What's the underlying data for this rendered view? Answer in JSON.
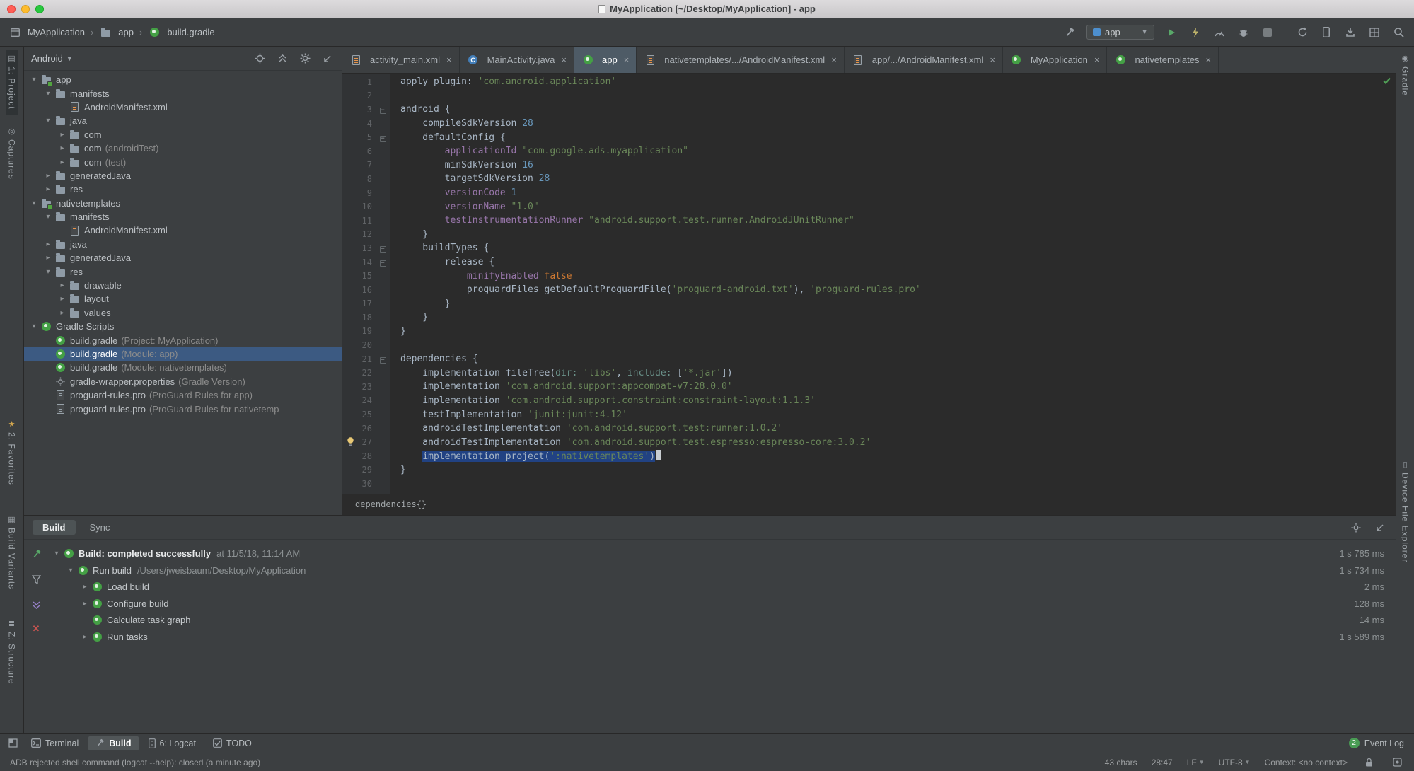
{
  "colors": {
    "editor_selection": "#214283",
    "tree_selection": "#3C5A82",
    "string_green": "#6A8759",
    "number_blue": "#6897BB",
    "keyword_orange": "#CC7832",
    "member_purple": "#9876AA",
    "gradle_green": "#44A045",
    "run_green": "#59A869",
    "close_red": "#C75450",
    "favorites_star": "#D0A54E"
  },
  "titlebar": {
    "title": "MyApplication [~/Desktop/MyApplication] - app"
  },
  "toolbar": {
    "breadcrumbs": [
      {
        "label": "MyApplication",
        "icon": "project"
      },
      {
        "label": "app",
        "icon": "folder"
      },
      {
        "label": "build.gradle",
        "icon": "gradle"
      }
    ],
    "run_config": "app"
  },
  "left_strip": {
    "top": [
      {
        "label": "1: Project",
        "icon": "project-tool",
        "active": true
      },
      {
        "label": "Captures",
        "icon": "captures",
        "active": false
      }
    ],
    "bottom": [
      {
        "label": "2: Favorites",
        "icon": "favorites",
        "active": false
      },
      {
        "label": "Build Variants",
        "icon": "build-variants",
        "active": false
      },
      {
        "label": "Z: Structure",
        "icon": "structure",
        "active": false
      }
    ]
  },
  "right_strip": {
    "top": [
      {
        "label": "Gradle",
        "icon": "gradle-strip",
        "active": false
      }
    ],
    "bottom": [
      {
        "label": "Device File Explorer",
        "icon": "device-explorer",
        "active": false
      }
    ]
  },
  "project": {
    "view": "Android",
    "tree": [
      {
        "indent": 0,
        "arrow": "▾",
        "icon": "module",
        "label": "app",
        "note": "",
        "selected": false
      },
      {
        "indent": 1,
        "arrow": "▾",
        "icon": "folder",
        "label": "manifests",
        "note": "",
        "selected": false
      },
      {
        "indent": 2,
        "arrow": "",
        "icon": "manifest",
        "label": "AndroidManifest.xml",
        "note": "",
        "selected": false
      },
      {
        "indent": 1,
        "arrow": "▾",
        "icon": "folder",
        "label": "java",
        "note": "",
        "selected": false
      },
      {
        "indent": 2,
        "arrow": "▸",
        "icon": "package",
        "label": "com",
        "note": "",
        "selected": false
      },
      {
        "indent": 2,
        "arrow": "▸",
        "icon": "package",
        "label": "com",
        "note": "(androidTest)",
        "selected": false
      },
      {
        "indent": 2,
        "arrow": "▸",
        "icon": "package",
        "label": "com",
        "note": "(test)",
        "selected": false
      },
      {
        "indent": 1,
        "arrow": "▸",
        "icon": "folder",
        "label": "generatedJava",
        "note": "",
        "selected": false
      },
      {
        "indent": 1,
        "arrow": "▸",
        "icon": "folder",
        "label": "res",
        "note": "",
        "selected": false
      },
      {
        "indent": 0,
        "arrow": "▾",
        "icon": "module",
        "label": "nativetemplates",
        "note": "",
        "selected": false
      },
      {
        "indent": 1,
        "arrow": "▾",
        "icon": "folder",
        "label": "manifests",
        "note": "",
        "selected": false
      },
      {
        "indent": 2,
        "arrow": "",
        "icon": "manifest",
        "label": "AndroidManifest.xml",
        "note": "",
        "selected": false
      },
      {
        "indent": 1,
        "arrow": "▸",
        "icon": "folder",
        "label": "java",
        "note": "",
        "selected": false
      },
      {
        "indent": 1,
        "arrow": "▸",
        "icon": "folder",
        "label": "generatedJava",
        "note": "",
        "selected": false
      },
      {
        "indent": 1,
        "arrow": "▾",
        "icon": "folder",
        "label": "res",
        "note": "",
        "selected": false
      },
      {
        "indent": 2,
        "arrow": "▸",
        "icon": "folder",
        "label": "drawable",
        "note": "",
        "selected": false
      },
      {
        "indent": 2,
        "arrow": "▸",
        "icon": "folder",
        "label": "layout",
        "note": "",
        "selected": false
      },
      {
        "indent": 2,
        "arrow": "▸",
        "icon": "folder",
        "label": "values",
        "note": "",
        "selected": false
      },
      {
        "indent": 0,
        "arrow": "▾",
        "icon": "gradle",
        "label": "Gradle Scripts",
        "note": "",
        "selected": false
      },
      {
        "indent": 1,
        "arrow": "",
        "icon": "gradle",
        "label": "build.gradle",
        "note": "(Project: MyApplication)",
        "selected": false
      },
      {
        "indent": 1,
        "arrow": "",
        "icon": "gradle",
        "label": "build.gradle",
        "note": "(Module: app)",
        "selected": true
      },
      {
        "indent": 1,
        "arrow": "",
        "icon": "gradle",
        "label": "build.gradle",
        "note": "(Module: nativetemplates)",
        "selected": false
      },
      {
        "indent": 1,
        "arrow": "",
        "icon": "wrapper",
        "label": "gradle-wrapper.properties",
        "note": "(Gradle Version)",
        "selected": false
      },
      {
        "indent": 1,
        "arrow": "",
        "icon": "textfile",
        "label": "proguard-rules.pro",
        "note": "(ProGuard Rules for app)",
        "selected": false
      },
      {
        "indent": 1,
        "arrow": "",
        "icon": "textfile",
        "label": "proguard-rules.pro",
        "note": "(ProGuard Rules for nativetemp",
        "selected": false
      }
    ]
  },
  "editor": {
    "active_index": 2,
    "tabs": [
      {
        "label": "activity_main.xml",
        "icon": "xml"
      },
      {
        "label": "MainActivity.java",
        "icon": "class"
      },
      {
        "label": "app",
        "icon": "gradle"
      },
      {
        "label": "nativetemplates/.../AndroidManifest.xml",
        "icon": "manifest"
      },
      {
        "label": "app/.../AndroidManifest.xml",
        "icon": "manifest"
      },
      {
        "label": "MyApplication",
        "icon": "gradle"
      },
      {
        "label": "nativetemplates",
        "icon": "gradle"
      }
    ],
    "breadcrumb": "dependencies{}",
    "lines": [
      {
        "num": "1",
        "segs": [
          [
            "p",
            "apply plugin: "
          ],
          [
            "s",
            "'com.android.application'"
          ]
        ]
      },
      {
        "num": "2",
        "segs": []
      },
      {
        "num": "3",
        "fold": true,
        "segs": [
          [
            "p",
            "android {"
          ]
        ]
      },
      {
        "num": "4",
        "segs": [
          [
            "p",
            "    compileSdkVersion "
          ],
          [
            "n",
            "28"
          ]
        ]
      },
      {
        "num": "5",
        "fold": true,
        "segs": [
          [
            "p",
            "    defaultConfig {"
          ]
        ]
      },
      {
        "num": "6",
        "segs": [
          [
            "p",
            "        "
          ],
          [
            "m",
            "applicationId"
          ],
          [
            "p",
            " "
          ],
          [
            "s",
            "\"com.google.ads.myapplication\""
          ]
        ]
      },
      {
        "num": "7",
        "segs": [
          [
            "p",
            "        minSdkVersion "
          ],
          [
            "n",
            "16"
          ]
        ]
      },
      {
        "num": "8",
        "segs": [
          [
            "p",
            "        targetSdkVersion "
          ],
          [
            "n",
            "28"
          ]
        ]
      },
      {
        "num": "9",
        "segs": [
          [
            "p",
            "        "
          ],
          [
            "m",
            "versionCode"
          ],
          [
            "p",
            " "
          ],
          [
            "n",
            "1"
          ]
        ]
      },
      {
        "num": "10",
        "segs": [
          [
            "p",
            "        "
          ],
          [
            "m",
            "versionName"
          ],
          [
            "p",
            " "
          ],
          [
            "s",
            "\"1.0\""
          ]
        ]
      },
      {
        "num": "11",
        "segs": [
          [
            "p",
            "        "
          ],
          [
            "m",
            "testInstrumentationRunner"
          ],
          [
            "p",
            " "
          ],
          [
            "s",
            "\"android.support.test.runner.AndroidJUnitRunner\""
          ]
        ]
      },
      {
        "num": "12",
        "segs": [
          [
            "p",
            "    }"
          ]
        ]
      },
      {
        "num": "13",
        "fold": true,
        "segs": [
          [
            "p",
            "    buildTypes {"
          ]
        ]
      },
      {
        "num": "14",
        "fold": true,
        "segs": [
          [
            "p",
            "        release {"
          ]
        ]
      },
      {
        "num": "15",
        "segs": [
          [
            "p",
            "            "
          ],
          [
            "m",
            "minifyEnabled"
          ],
          [
            "p",
            " "
          ],
          [
            "k",
            "false"
          ]
        ]
      },
      {
        "num": "16",
        "segs": [
          [
            "p",
            "            proguardFiles getDefaultProguardFile("
          ],
          [
            "s",
            "'proguard-android.txt'"
          ],
          [
            "p",
            "), "
          ],
          [
            "s",
            "'proguard-rules.pro'"
          ]
        ]
      },
      {
        "num": "17",
        "segs": [
          [
            "p",
            "        }"
          ]
        ]
      },
      {
        "num": "18",
        "segs": [
          [
            "p",
            "    }"
          ]
        ]
      },
      {
        "num": "19",
        "segs": [
          [
            "p",
            "}"
          ]
        ]
      },
      {
        "num": "20",
        "segs": []
      },
      {
        "num": "21",
        "fold": true,
        "segs": [
          [
            "p",
            "dependencies {"
          ]
        ]
      },
      {
        "num": "22",
        "segs": [
          [
            "p",
            "    implementation fileTree("
          ],
          [
            "a",
            "dir:"
          ],
          [
            "p",
            " "
          ],
          [
            "s",
            "'libs'"
          ],
          [
            "p",
            ", "
          ],
          [
            "a",
            "include:"
          ],
          [
            "p",
            " ["
          ],
          [
            "s",
            "'*.jar'"
          ],
          [
            "p",
            "])"
          ]
        ]
      },
      {
        "num": "23",
        "segs": [
          [
            "p",
            "    implementation "
          ],
          [
            "s",
            "'com.android.support:appcompat-v7:28.0.0'"
          ]
        ]
      },
      {
        "num": "24",
        "segs": [
          [
            "p",
            "    implementation "
          ],
          [
            "s",
            "'com.android.support.constraint:constraint-layout:1.1.3'"
          ]
        ]
      },
      {
        "num": "25",
        "segs": [
          [
            "p",
            "    testImplementation "
          ],
          [
            "s",
            "'junit:junit:4.12'"
          ]
        ]
      },
      {
        "num": "26",
        "segs": [
          [
            "p",
            "    androidTestImplementation "
          ],
          [
            "s",
            "'com.android.support.test:runner:1.0.2'"
          ]
        ]
      },
      {
        "num": "27",
        "bulb": true,
        "segs": [
          [
            "p",
            "    androidTestImplementation "
          ],
          [
            "s",
            "'com.android.support.test.espresso:espresso-core:3.0.2'"
          ]
        ]
      },
      {
        "num": "28",
        "caret": true,
        "segs": [
          [
            "p",
            "    "
          ],
          [
            "pS",
            "implementation project("
          ],
          [
            "sS",
            "':nativetemplates'"
          ],
          [
            "pS",
            ")"
          ]
        ]
      },
      {
        "num": "29",
        "segs": [
          [
            "p",
            "}"
          ]
        ]
      },
      {
        "num": "30",
        "segs": []
      }
    ]
  },
  "build": {
    "tabs": [
      {
        "label": "Build",
        "active": true
      },
      {
        "label": "Sync",
        "active": false
      }
    ],
    "rows": [
      {
        "indent": 0,
        "arrow": "▾",
        "title": "Build: completed successfully",
        "bold": true,
        "note": "at 11/5/18, 11:14 AM",
        "time": "1 s 785 ms"
      },
      {
        "indent": 1,
        "arrow": "▾",
        "title": "Run build",
        "bold": false,
        "note": "/Users/jweisbaum/Desktop/MyApplication",
        "time": "1 s 734 ms"
      },
      {
        "indent": 2,
        "arrow": "▸",
        "title": "Load build",
        "bold": false,
        "note": "",
        "time": "2 ms"
      },
      {
        "indent": 2,
        "arrow": "▸",
        "title": "Configure build",
        "bold": false,
        "note": "",
        "time": "128 ms"
      },
      {
        "indent": 2,
        "arrow": "",
        "title": "Calculate task graph",
        "bold": false,
        "note": "",
        "time": "14 ms"
      },
      {
        "indent": 2,
        "arrow": "▸",
        "title": "Run tasks",
        "bold": false,
        "note": "",
        "time": "1 s 589 ms"
      }
    ]
  },
  "bottom_bar": {
    "window_items": [
      {
        "label": "Terminal",
        "icon": "terminal",
        "active": false
      },
      {
        "label": "Build",
        "icon": "build-hammer",
        "active": true
      },
      {
        "label": "6: Logcat",
        "icon": "logcat",
        "active": false
      },
      {
        "label": "TODO",
        "icon": "todo",
        "active": false
      }
    ],
    "event_log": {
      "label": "Event Log",
      "badge": "2"
    }
  },
  "status_bar": {
    "message": "ADB rejected shell command (logcat --help): closed (a minute ago)",
    "chars": "43 chars",
    "caret_position": "28:47",
    "line_separator": "LF",
    "encoding": "UTF-8",
    "context": "Context: <no context>"
  }
}
